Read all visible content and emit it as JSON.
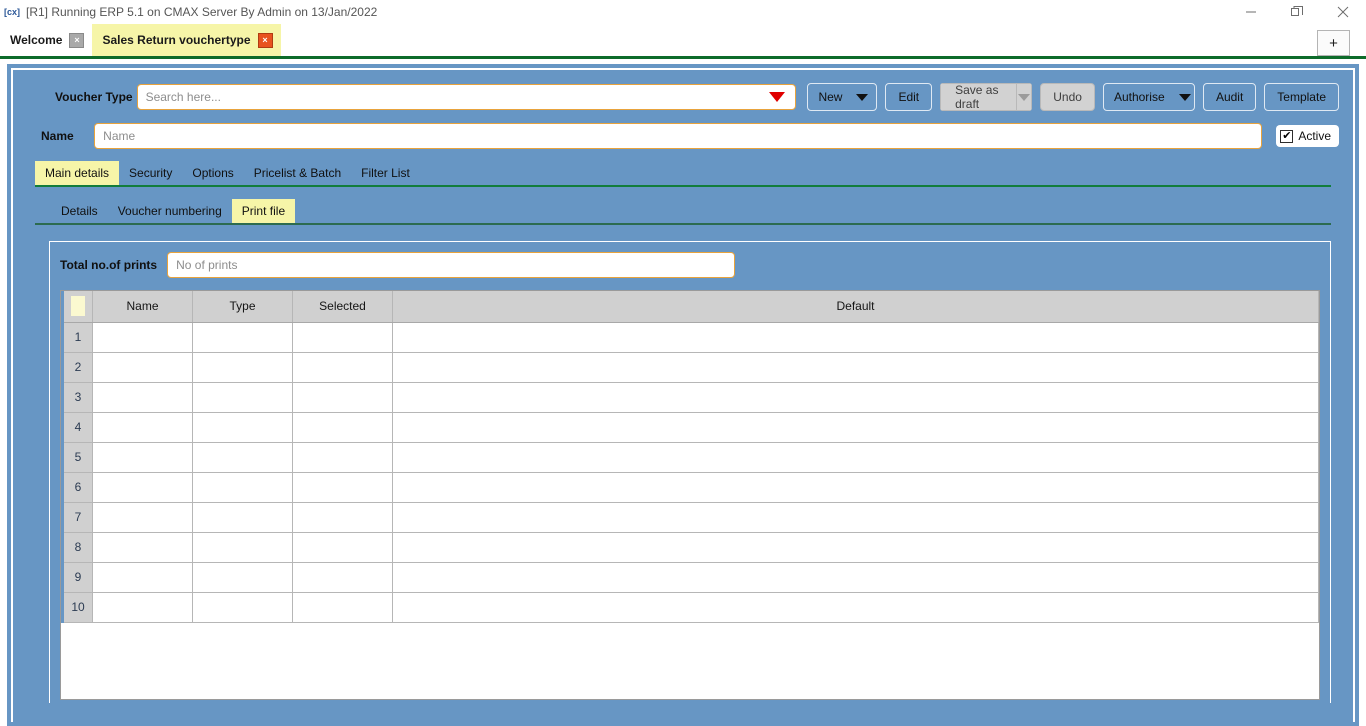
{
  "window": {
    "icon": "app-icon",
    "title": "[R1] Running ERP 5.1 on CMAX Server By Admin on 13/Jan/2022",
    "minimize_label": "minimize-icon",
    "restore_label": "restore-icon",
    "close_label": "close-icon"
  },
  "doc_tabs": {
    "items": [
      {
        "label": "Welcome",
        "active": false,
        "close": "×"
      },
      {
        "label": "Sales Return vouchertype",
        "active": true,
        "close": "×"
      }
    ],
    "new_tab_label": "+"
  },
  "form": {
    "voucher_type_label": "Voucher Type",
    "voucher_type_placeholder": "Search here...",
    "voucher_type_value": "",
    "name_label": "Name",
    "name_placeholder": "Name",
    "name_value": "",
    "active_label": "Active",
    "active_checked": true,
    "active_check_glyph": "✔"
  },
  "toolbar": {
    "new_label": "New",
    "edit_label": "Edit",
    "save_as_draft_label": "Save as draft",
    "undo_label": "Undo",
    "authorise_label": "Authorise",
    "audit_label": "Audit",
    "template_label": "Template"
  },
  "tabs_level1": {
    "items": [
      {
        "label": "Main details",
        "active": true
      },
      {
        "label": "Security",
        "active": false
      },
      {
        "label": "Options",
        "active": false
      },
      {
        "label": "Pricelist & Batch",
        "active": false
      },
      {
        "label": "Filter List",
        "active": false
      }
    ]
  },
  "tabs_level2": {
    "items": [
      {
        "label": "Details",
        "active": false
      },
      {
        "label": "Voucher numbering",
        "active": false
      },
      {
        "label": "Print file",
        "active": true
      }
    ]
  },
  "print_file": {
    "total_prints_label": "Total no.of prints",
    "total_prints_placeholder": "No of prints",
    "total_prints_value": "",
    "grid": {
      "columns": [
        "",
        "Name",
        "Type",
        "Selected",
        "Default"
      ],
      "rows": [
        {
          "num": "1",
          "name": "",
          "type": "",
          "selected": "",
          "default": ""
        },
        {
          "num": "2",
          "name": "",
          "type": "",
          "selected": "",
          "default": ""
        },
        {
          "num": "3",
          "name": "",
          "type": "",
          "selected": "",
          "default": ""
        },
        {
          "num": "4",
          "name": "",
          "type": "",
          "selected": "",
          "default": ""
        },
        {
          "num": "5",
          "name": "",
          "type": "",
          "selected": "",
          "default": ""
        },
        {
          "num": "6",
          "name": "",
          "type": "",
          "selected": "",
          "default": ""
        },
        {
          "num": "7",
          "name": "",
          "type": "",
          "selected": "",
          "default": ""
        },
        {
          "num": "8",
          "name": "",
          "type": "",
          "selected": "",
          "default": ""
        },
        {
          "num": "9",
          "name": "",
          "type": "",
          "selected": "",
          "default": ""
        },
        {
          "num": "10",
          "name": "",
          "type": "",
          "selected": "",
          "default": ""
        }
      ]
    }
  },
  "colors": {
    "panel_blue": "#6796c4",
    "tab_active_yellow": "#f6f5a8",
    "accent_green": "#0d6b2a",
    "field_border_orange": "#e8a33d",
    "dropdown_red": "#e00000",
    "grid_header_gray": "#d0d0d0",
    "close_red": "#e8531f"
  }
}
